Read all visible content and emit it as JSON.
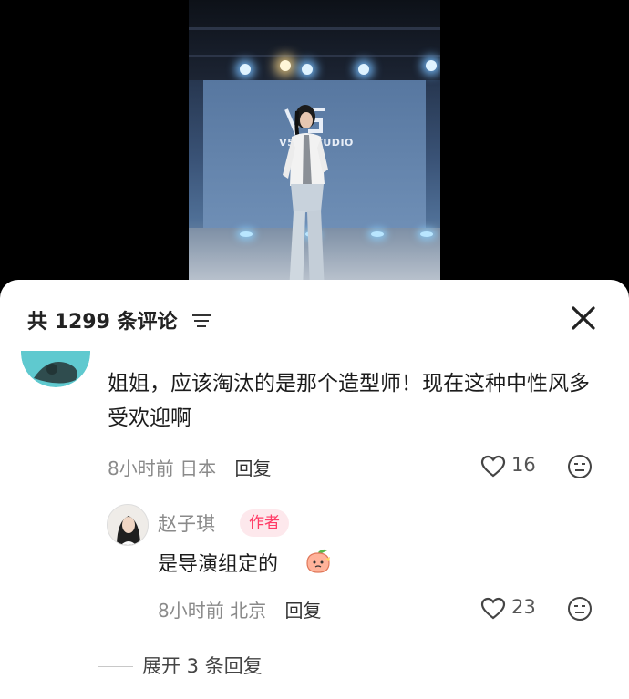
{
  "video": {
    "wall_text": "V5D     TUDIO"
  },
  "comments_panel": {
    "title": "共 1299 条评论",
    "comment": {
      "text": "姐姐，应该淘汰的是那个造型师！现在这种中性风多受欢迎啊",
      "time": "8小时前",
      "location": "日本",
      "reply_label": "回复",
      "likes": "16"
    },
    "reply": {
      "author": "赵子琪",
      "badge": "作者",
      "text": "是导演组定的",
      "time": "8小时前",
      "location": "北京",
      "reply_label": "回复",
      "likes": "23"
    },
    "expand_label": "展开 3 条回复"
  },
  "icons": {
    "sort": "sort-lines-icon",
    "close": "close-x-icon",
    "like": "heart-outline-icon",
    "dislike": "neutral-face-icon",
    "emoji": "peach-emoji"
  },
  "colors": {
    "badge_text": "#ff3b66",
    "badge_bg": "#fde8ec",
    "meta_text": "#8a8a8a"
  }
}
